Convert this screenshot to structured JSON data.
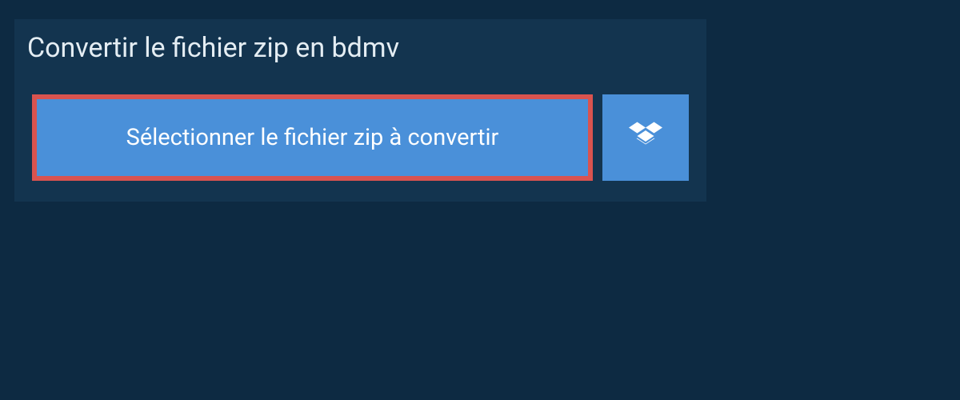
{
  "header": {
    "title": "Convertir le fichier zip en bdmv"
  },
  "actions": {
    "select_label": "Sélectionner le fichier zip à convertir"
  }
}
